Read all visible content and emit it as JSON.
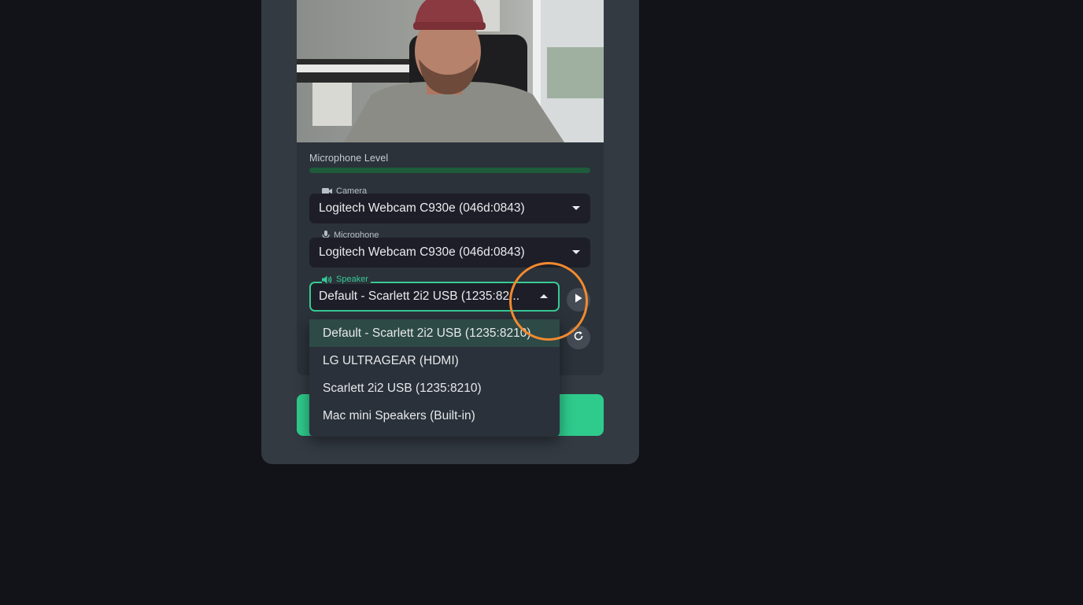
{
  "video": {
    "alt": "Webcam preview"
  },
  "mic_level": {
    "label": "Microphone Level",
    "level": 1.0,
    "color": "#1d5b3b"
  },
  "camera": {
    "label": "Camera",
    "icon": "video-camera-icon",
    "value": "Logitech Webcam C930e (046d:0843)"
  },
  "microphone": {
    "label": "Microphone",
    "icon": "microphone-icon",
    "value": "Logitech Webcam C930e (046d:0843)"
  },
  "speaker": {
    "label": "Speaker",
    "icon": "speaker-icon",
    "value": "Default - Scarlett 2i2 USB (1235:82...",
    "options": [
      "Default - Scarlett 2i2 USB (1235:8210)",
      "LG ULTRAGEAR (HDMI)",
      "Scarlett 2i2 USB (1235:8210)",
      "Mac mini Speakers (Built-in)"
    ],
    "selected_index": 0
  },
  "buttons": {
    "play_icon": "play-icon",
    "refresh_icon": "refresh-icon"
  },
  "colors": {
    "accent": "#37c995",
    "primary_button": "#2fcb8d",
    "highlight_ring": "#f28a2f"
  }
}
